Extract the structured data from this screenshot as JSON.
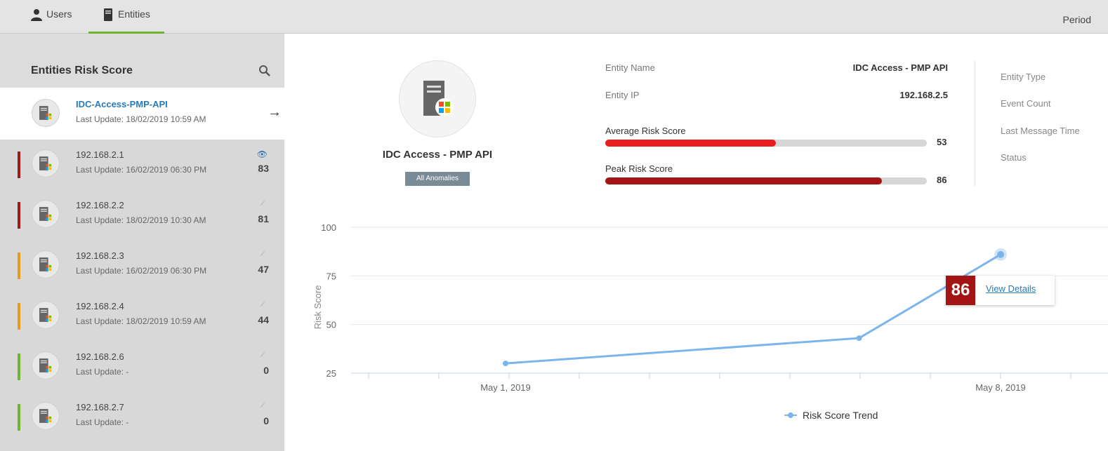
{
  "tabs": [
    {
      "label": "Users",
      "icon": "user-icon"
    },
    {
      "label": "Entities",
      "icon": "server-icon"
    }
  ],
  "period_label": "Period",
  "sidebar": {
    "title": "Entities Risk Score",
    "selected": {
      "name": "IDC-Access-PMP-API",
      "update": "Last Update: 18/02/2019 10:59 AM"
    },
    "items": [
      {
        "name": "192.168.2.1",
        "update": "Last Update: 16/02/2019 06:30 PM",
        "score": "83",
        "severity_color": "#9b1c1c",
        "watched": true
      },
      {
        "name": "192.168.2.2",
        "update": "Last Update: 18/02/2019 10:30 AM",
        "score": "81",
        "severity_color": "#9b1c1c",
        "watched": false
      },
      {
        "name": "192.168.2.3",
        "update": "Last Update: 16/02/2019 06:30 PM",
        "score": "47",
        "severity_color": "#e69a1f",
        "watched": false
      },
      {
        "name": "192.168.2.4",
        "update": "Last Update: 18/02/2019 10:59 AM",
        "score": "44",
        "severity_color": "#e69a1f",
        "watched": false
      },
      {
        "name": "192.168.2.6",
        "update": "Last Update: -",
        "score": "0",
        "severity_color": "#6fb530",
        "watched": false
      },
      {
        "name": "192.168.2.7",
        "update": "Last Update: -",
        "score": "0",
        "severity_color": "#6fb530",
        "watched": false
      }
    ]
  },
  "entity": {
    "title": "IDC Access - PMP API",
    "badge": "All Anomalies",
    "name_label": "Entity Name",
    "name_value": "IDC Access - PMP API",
    "ip_label": "Entity IP",
    "ip_value": "192.168.2.5",
    "avg_label": "Average Risk Score",
    "avg_value": "53",
    "avg_fraction": 0.53,
    "peak_label": "Peak Risk Score",
    "peak_value": "86",
    "peak_fraction": 0.86,
    "type_label": "Entity Type",
    "event_label": "Event Count",
    "last_msg_label": "Last Message Time",
    "status_label": "Status"
  },
  "colors": {
    "accent_green": "#6fb530",
    "avg_bar": "#e81d1d",
    "peak_bar": "#a31515",
    "line": "#7cb5ec",
    "link": "#2a7ab8"
  },
  "chart_data": {
    "type": "line",
    "ylabel": "Risk Score",
    "y_ticks": [
      "100",
      "75",
      "50",
      "25"
    ],
    "ylim": [
      25,
      100
    ],
    "x_labels": [
      "May 1, 2019",
      "May 8, 2019"
    ],
    "series": [
      {
        "name": "Risk Score Trend",
        "x": [
          "2019-05-01",
          "2019-05-06",
          "2019-05-08"
        ],
        "values": [
          30,
          43,
          86
        ]
      }
    ],
    "tooltip": {
      "value": "86",
      "link_text": "View Details"
    },
    "grid": true,
    "legend": "bottom-center"
  }
}
